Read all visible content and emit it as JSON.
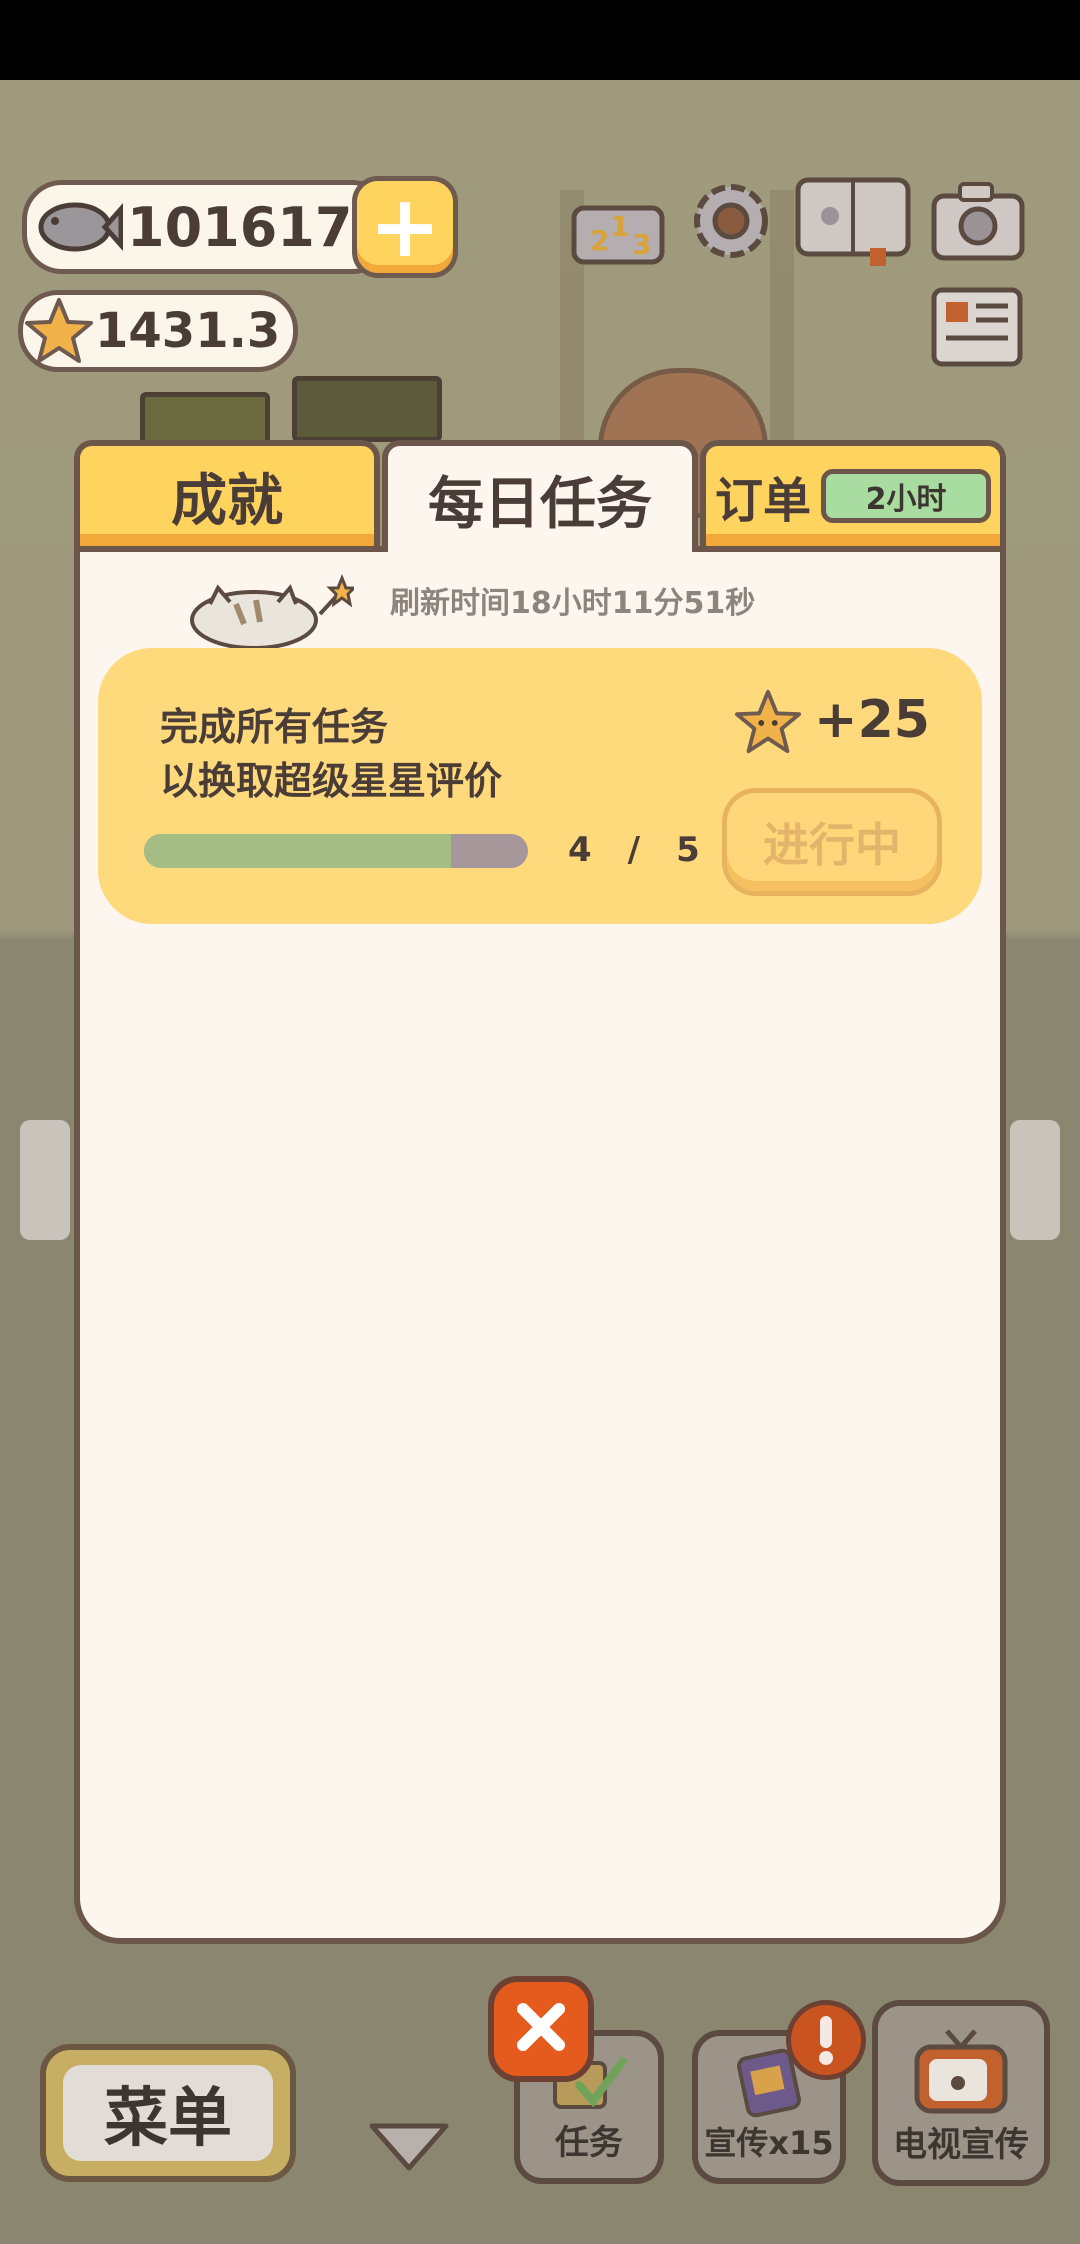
{
  "hud": {
    "fish_count": "101617",
    "star_rating": "1431.3",
    "icons": [
      "fish-icon",
      "plus-icon",
      "star-icon",
      "ranking-icon",
      "settings-gear-icon",
      "catbook-icon",
      "camera-icon",
      "newspaper-icon"
    ]
  },
  "tabs": {
    "achievements": "成就",
    "daily_tasks": "每日任务",
    "orders": "订单",
    "orders_timer": "2小时",
    "active": "daily_tasks"
  },
  "panel": {
    "refresh_text": "刷新时间18小时11分51秒"
  },
  "task": {
    "line1": "完成所有任务",
    "line2": "以换取超级星星评价",
    "progress_current": "4",
    "progress_sep": "/",
    "progress_total": "5",
    "progress_fraction": 0.8,
    "reward": "+25",
    "button": "进行中"
  },
  "bottom": {
    "menu": "菜单",
    "tasks": "任务",
    "promo": "宣传x15",
    "tv_promo": "电视宣传"
  },
  "colors": {
    "tab_yellow": "#ffd45e",
    "card_yellow": "#ffda7d",
    "progress_green": "#a4bd85",
    "close_orange": "#e55b1d",
    "border_brown": "#6c564a"
  }
}
